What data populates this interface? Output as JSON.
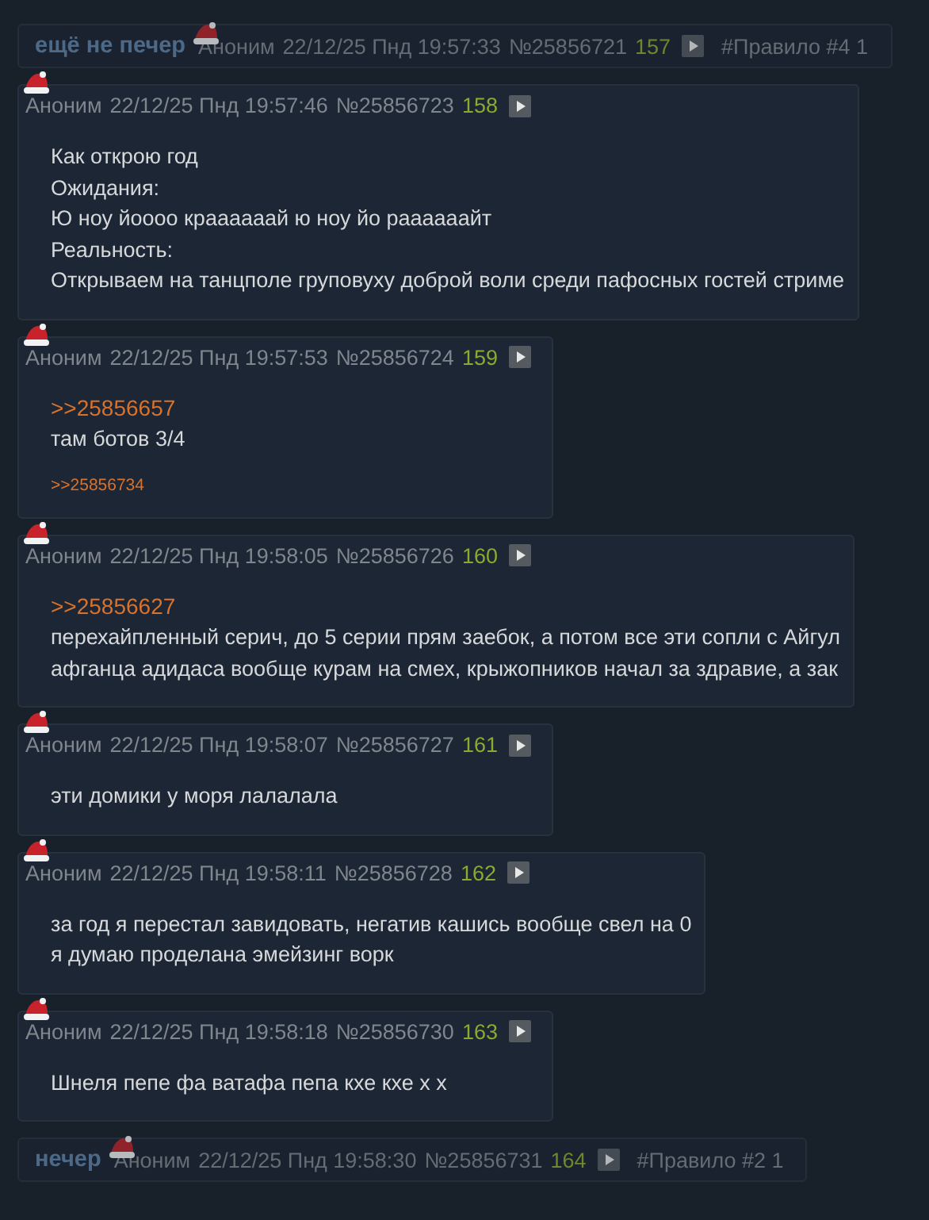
{
  "posts": [
    {
      "kind": "hidden",
      "title": "ещё не печер",
      "author": "Аноним",
      "date": "22/12/25 Пнд 19:57:33",
      "number": "№25856721",
      "index": "157",
      "tag": "#Правило #4 1"
    },
    {
      "kind": "full",
      "author": "Аноним",
      "date": "22/12/25 Пнд 19:57:46",
      "number": "№25856723",
      "index": "158",
      "body": [
        {
          "kind": "text",
          "text": "Как открою год"
        },
        {
          "kind": "text",
          "text": "Ожидания:"
        },
        {
          "kind": "text",
          "text": "Ю ноу йоооо краааааай ю ноу йо раааааайт"
        },
        {
          "kind": "text",
          "text": "Реальность:"
        },
        {
          "kind": "text",
          "text": "Открываем на танцполе груповуху доброй воли среди пафосных гостей стриме"
        }
      ]
    },
    {
      "kind": "full",
      "author": "Аноним",
      "date": "22/12/25 Пнд 19:57:53",
      "number": "№25856724",
      "index": "159",
      "body": [
        {
          "kind": "quote",
          "text": ">>25856657"
        },
        {
          "kind": "text",
          "text": "там ботов 3/4"
        }
      ],
      "replies": [
        ">>25856734"
      ]
    },
    {
      "kind": "full",
      "author": "Аноним",
      "date": "22/12/25 Пнд 19:58:05",
      "number": "№25856726",
      "index": "160",
      "body": [
        {
          "kind": "quote",
          "text": ">>25856627"
        },
        {
          "kind": "text",
          "text": "перехайпленный серич, до 5 серии прям заебок, а потом все эти сопли с Айгул"
        },
        {
          "kind": "text",
          "text": "афганца адидаса вообще курам на смех, крыжопников начал за здравие, а зак"
        }
      ]
    },
    {
      "kind": "full",
      "author": "Аноним",
      "date": "22/12/25 Пнд 19:58:07",
      "number": "№25856727",
      "index": "161",
      "body": [
        {
          "kind": "text",
          "text": "эти домики у моря лалалала"
        }
      ]
    },
    {
      "kind": "full",
      "author": "Аноним",
      "date": "22/12/25 Пнд 19:58:11",
      "number": "№25856728",
      "index": "162",
      "body": [
        {
          "kind": "text",
          "text": "за год я перестал завидовать, негатив кашись вообще свел на 0"
        },
        {
          "kind": "text",
          "text": "я думаю проделана эмейзинг ворк"
        }
      ]
    },
    {
      "kind": "full",
      "author": "Аноним",
      "date": "22/12/25 Пнд 19:58:18",
      "number": "№25856730",
      "index": "163",
      "body": [
        {
          "kind": "text",
          "text": "Шнеля пепе фа ватафа пепа кхе кхе х х"
        }
      ]
    },
    {
      "kind": "hidden",
      "title": "нечер",
      "author": "Аноним",
      "date": "22/12/25 Пнд 19:58:30",
      "number": "№25856731",
      "index": "164",
      "tag": "#Правило #2 1"
    }
  ]
}
